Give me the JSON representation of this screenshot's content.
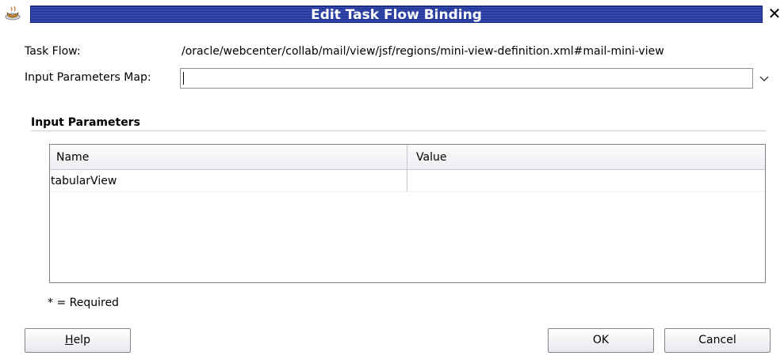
{
  "window": {
    "title": "Edit Task Flow Binding",
    "close_glyph": "✕",
    "icon": "java-cup-icon"
  },
  "form": {
    "task_flow_label": "Task Flow:",
    "task_flow_value": "/oracle/webcenter/collab/mail/view/jsf/regions/mini-view-definition.xml#mail-mini-view",
    "map_label": "Input Parameters Map:",
    "map_value": ""
  },
  "section": {
    "title": "Input Parameters"
  },
  "table": {
    "columns": [
      "Name",
      "Value"
    ],
    "rows": [
      {
        "name": "tabularView",
        "value": ""
      }
    ]
  },
  "required_note": "* = Required",
  "buttons": {
    "help_mnemonic": "H",
    "help_rest": "elp",
    "ok": "OK",
    "cancel": "Cancel"
  },
  "colors": {
    "title_bar": "#1c2f8e",
    "title_text": "#ffffff"
  }
}
